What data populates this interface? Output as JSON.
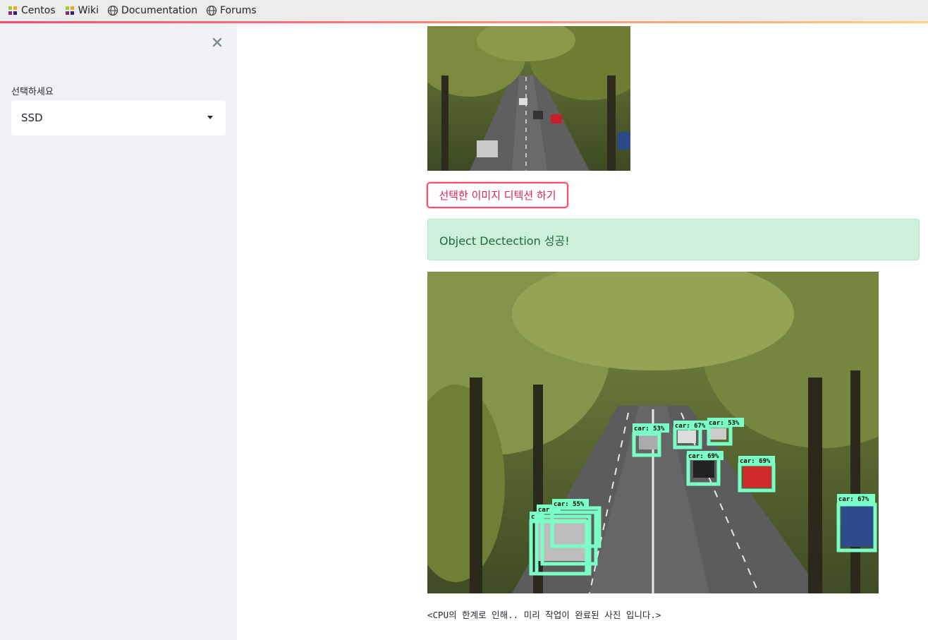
{
  "bookmarks": [
    {
      "label": "Centos",
      "icon": "centos-icon"
    },
    {
      "label": "Wiki",
      "icon": "centos-icon"
    },
    {
      "label": "Documentation",
      "icon": "globe-icon"
    },
    {
      "label": "Forums",
      "icon": "globe-icon"
    }
  ],
  "sidebar": {
    "close_icon": "close-icon",
    "select_label": "선택하세요",
    "select_value": "SSD"
  },
  "main": {
    "detect_button": "선택한 이미지 디텍션 하기",
    "success_message": "Object Dectection 성공!",
    "caption": "<CPU의 한계로 인해.. 미리 작업이 완료된 사진 입니다.>",
    "detections": [
      {
        "label": "car: 53%"
      },
      {
        "label": "car: 67%"
      },
      {
        "label": "car: 53%"
      },
      {
        "label": "car: 69%"
      },
      {
        "label": "car: 69%"
      },
      {
        "label": "car: 67%"
      },
      {
        "label": "car: 55%"
      },
      {
        "label": "car"
      },
      {
        "label": "c"
      }
    ]
  },
  "colors": {
    "accent": "#ff4b6e",
    "box": "#7affc7",
    "success_bg": "#cdf0d9",
    "sidebar_bg": "#f0f2f6"
  }
}
